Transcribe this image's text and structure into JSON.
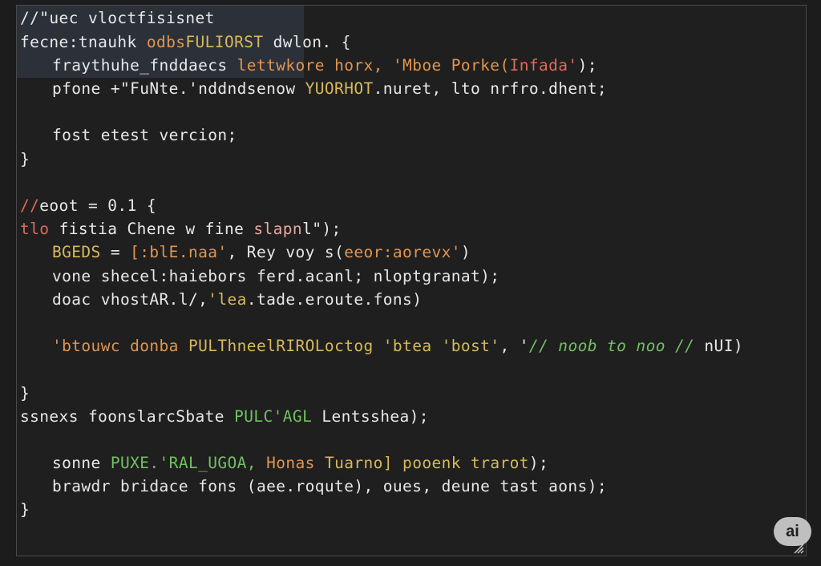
{
  "editor": {
    "lines": [
      {
        "segments": [
          {
            "text": "//\"uec vloctfisisnet",
            "color": "w"
          }
        ]
      },
      {
        "segments": [
          {
            "text": "fecne:tnauhk ",
            "color": "w"
          },
          {
            "text": "odbs",
            "color": "o"
          },
          {
            "text": "FULIORST",
            "color": "y"
          },
          {
            "text": " dwlon. {",
            "color": "w"
          }
        ]
      },
      {
        "segments": [
          {
            "text": "fraythuhe_fnddaecs ",
            "color": "w"
          },
          {
            "text": "lettwkore horx, 'Mboe Porke(",
            "color": "o"
          },
          {
            "text": "Infada'",
            "color": "r"
          },
          {
            "text": ");",
            "color": "w"
          }
        ]
      },
      {
        "segments": [
          {
            "text": "pfone +\"FuNte.'nddndsenow ",
            "color": "w"
          },
          {
            "text": "YUORHOT",
            "color": "y"
          },
          {
            "text": ".nuret, lto nrfro.dhent;",
            "color": "w"
          }
        ]
      },
      {
        "segments": []
      },
      {
        "segments": [
          {
            "text": "fost etest vercion;",
            "color": "w"
          }
        ]
      },
      {
        "segments": [
          {
            "text": "}",
            "color": "w"
          }
        ]
      },
      {
        "segments": []
      },
      {
        "segments": [
          {
            "text": "//",
            "color": "r"
          },
          {
            "text": "eoot = 0.1 {",
            "color": "w"
          }
        ]
      },
      {
        "segments": [
          {
            "text": "tlo ",
            "color": "r"
          },
          {
            "text": "fistia Chene w fine ",
            "color": "w"
          },
          {
            "text": "slapn",
            "color": "p"
          },
          {
            "text": "l\");",
            "color": "w"
          }
        ]
      },
      {
        "segments": [
          {
            "text": "BGEDS",
            "color": "y"
          },
          {
            "text": " = ",
            "color": "w"
          },
          {
            "text": "[:blE.naa'",
            "color": "o"
          },
          {
            "text": ", Rey voy s(",
            "color": "w"
          },
          {
            "text": "eeor:aorevx'",
            "color": "o"
          },
          {
            "text": ")",
            "color": "w"
          }
        ]
      },
      {
        "segments": [
          {
            "text": "vone shecel:haiebors ferd.acanl; nloptgranat);",
            "color": "w"
          }
        ]
      },
      {
        "segments": [
          {
            "text": "doac vhostAR.l/,",
            "color": "w"
          },
          {
            "text": "'lea",
            "color": "y"
          },
          {
            "text": ".tade.eroute.fons)",
            "color": "w"
          }
        ]
      },
      {
        "segments": []
      },
      {
        "segments": [
          {
            "text": "'btouwc donba ",
            "color": "o"
          },
          {
            "text": "PULThneelRIRO",
            "color": "y"
          },
          {
            "text": "Loctog ",
            "color": "y"
          },
          {
            "text": "'btea 'bost'",
            "color": "y"
          },
          {
            "text": ", '",
            "color": "w"
          },
          {
            "text": "// noob to noo //",
            "color": "gi"
          },
          {
            "text": " nUI)",
            "color": "w"
          }
        ]
      },
      {
        "segments": []
      },
      {
        "segments": [
          {
            "text": "}",
            "color": "w"
          }
        ]
      },
      {
        "segments": [
          {
            "text": "ssnexs foonslarcSbate ",
            "color": "w"
          },
          {
            "text": "PULC'AGL",
            "color": "g"
          },
          {
            "text": " Lentsshea);",
            "color": "w"
          }
        ]
      },
      {
        "segments": []
      },
      {
        "segments": [
          {
            "text": "sonne ",
            "color": "w"
          },
          {
            "text": "PUXE.'RAL_UGOA,",
            "color": "g"
          },
          {
            "text": " ",
            "color": "w"
          },
          {
            "text": "Honas",
            "color": "o"
          },
          {
            "text": " ",
            "color": "w"
          },
          {
            "text": "Tuarno] pooenk trarot",
            "color": "y"
          },
          {
            "text": ");",
            "color": "w"
          }
        ]
      },
      {
        "segments": [
          {
            "text": "brawdr bridace fons (aee.roqute), oues, deune tast aons);",
            "color": "w"
          }
        ]
      },
      {
        "segments": [
          {
            "text": "}",
            "color": "w"
          }
        ]
      }
    ]
  },
  "badge": {
    "label": "ai"
  },
  "colors": {
    "background": "#1f1f1f",
    "border": "#4a4a4a",
    "text": "#e8e8e8",
    "orange": "#e2954f",
    "red": "#e06a5a",
    "yellow": "#d7b95a",
    "green": "#72c063",
    "pink": "#e8a7a0",
    "selection": "#3a4a63",
    "badge": "#bfbfbf"
  },
  "icons": {
    "resize": "resize-grip-icon"
  }
}
